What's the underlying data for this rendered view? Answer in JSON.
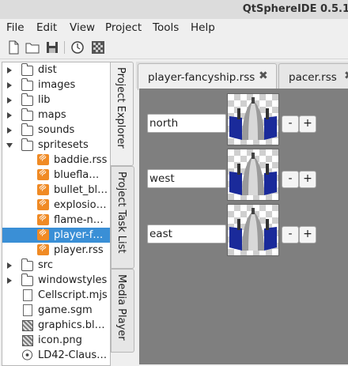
{
  "window": {
    "title": "QtSphereIDE 0.5.1"
  },
  "menu": {
    "file": "File",
    "edit": "Edit",
    "view": "View",
    "project": "Project",
    "tools": "Tools",
    "help": "Help"
  },
  "tree": [
    {
      "label": "dist",
      "icon": "folder-icon",
      "expand": "collapsed"
    },
    {
      "label": "images",
      "icon": "folder-icon",
      "expand": "collapsed"
    },
    {
      "label": "lib",
      "icon": "folder-icon",
      "expand": "collapsed"
    },
    {
      "label": "maps",
      "icon": "folder-icon",
      "expand": "collapsed"
    },
    {
      "label": "sounds",
      "icon": "folder-icon",
      "expand": "collapsed"
    },
    {
      "label": "spritesets",
      "icon": "folder-icon",
      "expand": "expanded"
    },
    {
      "label": "baddie.rss",
      "icon": "rss-icon"
    },
    {
      "label": "bluefla…",
      "icon": "rss-icon"
    },
    {
      "label": "bullet_bl…",
      "icon": "rss-icon"
    },
    {
      "label": "explosio…",
      "icon": "rss-icon"
    },
    {
      "label": "flame-n…",
      "icon": "rss-icon"
    },
    {
      "label": "player-f…",
      "icon": "rss-icon",
      "selected": true
    },
    {
      "label": "player.rss",
      "icon": "rss-icon"
    },
    {
      "label": "src",
      "icon": "folder-icon",
      "expand": "collapsed"
    },
    {
      "label": "windowstyles",
      "icon": "folder-icon",
      "expand": "collapsed"
    },
    {
      "label": "Cellscript.mjs",
      "icon": "script-file-icon"
    },
    {
      "label": "game.sgm",
      "icon": "document-file-icon"
    },
    {
      "label": "graphics.bl…",
      "icon": "image-file-icon"
    },
    {
      "label": "icon.png",
      "icon": "image-file-icon"
    },
    {
      "label": "LD42-Claus…",
      "icon": "disc-icon"
    }
  ],
  "side_tabs": {
    "project_explorer": "Project Explorer",
    "task_list": "Project Task List",
    "media_player": "Media Player"
  },
  "tabs": [
    {
      "label": "player-fancyship.rss",
      "close": "✖"
    },
    {
      "label": "pacer.rss",
      "close": "✖"
    }
  ],
  "directions": [
    {
      "name": "north",
      "minus": "-",
      "plus": "+"
    },
    {
      "name": "west",
      "minus": "-",
      "plus": "+"
    },
    {
      "name": "east",
      "minus": "-",
      "plus": "+"
    }
  ],
  "colors": {
    "selection": "#3a8fd6",
    "ship_wing": "#1a2a9a",
    "editor_bg": "#7f7f7f"
  }
}
